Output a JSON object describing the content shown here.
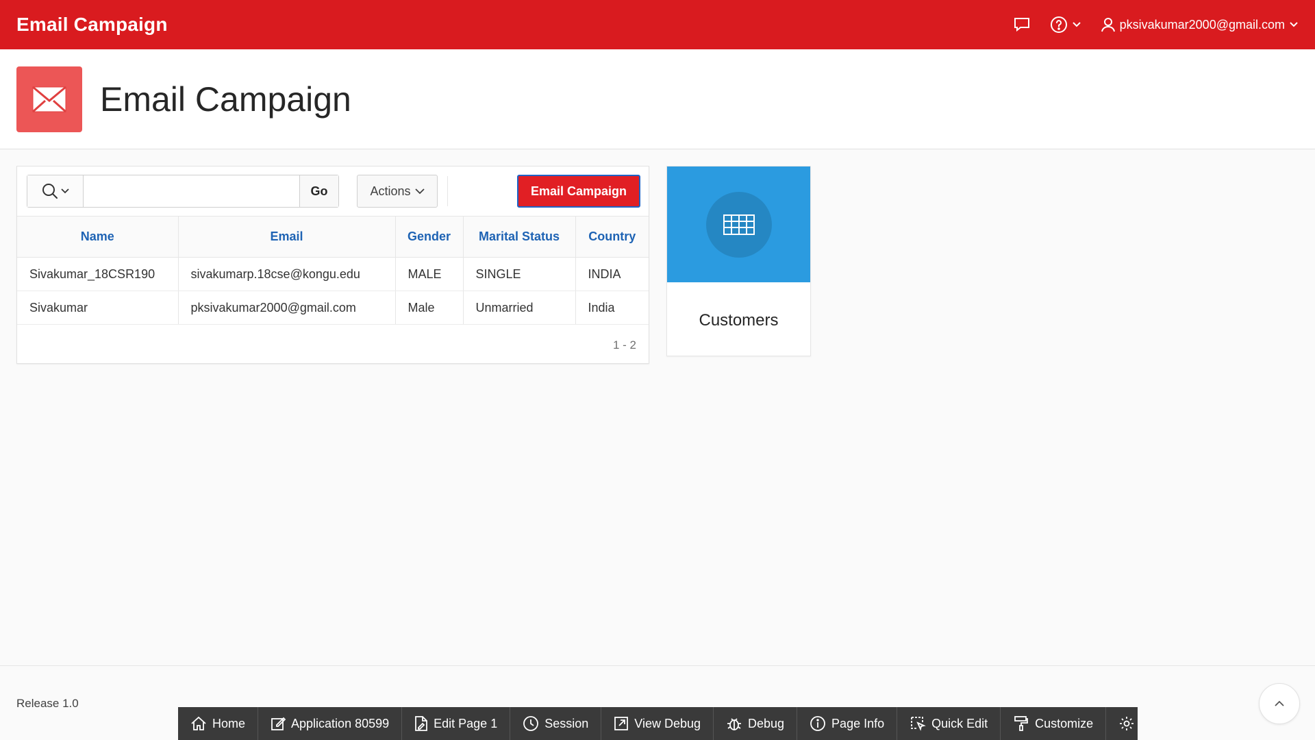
{
  "header": {
    "app_title": "Email Campaign",
    "username": "pksivakumar2000@gmail.com",
    "icons": [
      "chat-icon",
      "help-icon",
      "user-icon"
    ]
  },
  "hero": {
    "title": "Email Campaign",
    "icon": "envelope-icon",
    "icon_bg": "#ec5656"
  },
  "report": {
    "search": {
      "value": "",
      "placeholder": ""
    },
    "go_label": "Go",
    "actions_label": "Actions",
    "email_campaign_label": "Email Campaign",
    "columns": [
      "Name",
      "Email",
      "Gender",
      "Marital Status",
      "Country"
    ],
    "rows": [
      [
        "Sivakumar_18CSR190",
        "sivakumarp.18cse@kongu.edu",
        "MALE",
        "SINGLE",
        "INDIA"
      ],
      [
        "Sivakumar",
        "pksivakumar2000@gmail.com",
        "Male",
        "Unmarried",
        "India"
      ]
    ],
    "pagination": "1 - 2"
  },
  "card": {
    "label": "Customers",
    "icon": "table-grid-icon",
    "bg": "#2b9be0"
  },
  "footer": {
    "release": "Release 1.0"
  },
  "devbar": {
    "items": [
      {
        "label": "Home",
        "icon": "home-icon"
      },
      {
        "label": "Application 80599",
        "icon": "edit-icon"
      },
      {
        "label": "Edit Page 1",
        "icon": "page-edit-icon"
      },
      {
        "label": "Session",
        "icon": "session-icon"
      },
      {
        "label": "View Debug",
        "icon": "view-debug-icon"
      },
      {
        "label": "Debug",
        "icon": "bug-icon"
      },
      {
        "label": "Page Info",
        "icon": "info-icon"
      },
      {
        "label": "Quick Edit",
        "icon": "quick-edit-icon"
      },
      {
        "label": "Customize",
        "icon": "paint-roller-icon"
      },
      {
        "label": "",
        "icon": "gear-icon"
      }
    ]
  },
  "colors": {
    "header_bg": "#d91b1f",
    "button_red": "#e11f24",
    "link_blue": "#1e63b4",
    "devbar_bg": "#3a3a3a"
  }
}
